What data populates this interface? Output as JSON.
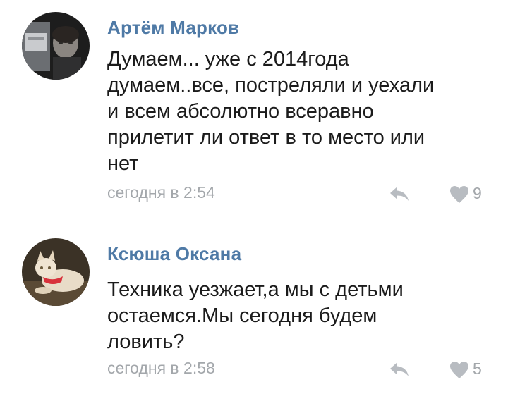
{
  "comments": [
    {
      "author": "Артём Марков",
      "lines": [
        "Думаем... уже с 2014года",
        "думаем..все, постреляли и уехали",
        "и всем абсолютно всеравно",
        "прилетит ли ответ в то место или",
        "нет"
      ],
      "time": "сегодня в 2:54",
      "likes": "9",
      "avatar_icon": "user-photo-man-icon"
    },
    {
      "author": "Ксюша Оксана",
      "lines": [
        "Техника уезжает,а мы с детьми",
        "остаемся.Мы сегодня будем",
        "ловить?"
      ],
      "time": "сегодня в 2:58",
      "likes": "5",
      "avatar_icon": "user-photo-cat-icon"
    }
  ],
  "icons": {
    "reply": "reply-icon",
    "like": "heart-icon"
  },
  "colors": {
    "author": "#4f7aa6",
    "text": "#1b1b1b",
    "meta": "#a3a7ab",
    "icon": "#b8bcc1",
    "divider": "#dfe2e6"
  }
}
